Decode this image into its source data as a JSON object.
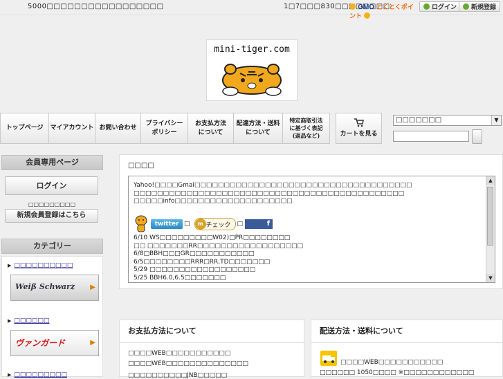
{
  "topbar": {
    "notice": "5000□□□□□□□□□□□□□□□□□",
    "ship_note": "1□7□□□830□□□□□□□□",
    "gmo_logo": "GMO",
    "gmo_points": "とくとくポイント",
    "login": "ログイン",
    "register": "新規登録"
  },
  "header": {
    "site_name": "mini-tiger.com"
  },
  "nav": {
    "items": [
      {
        "label": "トップページ"
      },
      {
        "label": "マイアカウント"
      },
      {
        "label": "お問い合わせ"
      },
      {
        "label": "プライバシー\nポリシー"
      },
      {
        "label": "お支払方法\nについて"
      },
      {
        "label": "配達方法・送料\nについて"
      },
      {
        "label": "特定商取引法\nに基づく表記\n(返品など)"
      }
    ],
    "cart_label": "カートを見る",
    "category_select": "□□□□□□□"
  },
  "sidebar": {
    "member_head": "会員専用ページ",
    "login_btn": "ログイン",
    "register_note": "□□□□□□□□□",
    "register_btn": "新規会員登録はこちら",
    "category_head": "カテゴリー",
    "categories": [
      {
        "label": "□□□□□□□□□□",
        "banner": "Weiß Schwarz"
      },
      {
        "label": "□□□□□□",
        "banner": "ヴァンガード"
      },
      {
        "label": "□□□□□□□□□"
      }
    ]
  },
  "news": {
    "title": "□□□□",
    "lines": [
      "Yahoo!□□□□Gmai□□□□□□□□□□□□□□□□□□□□□□□□□□□□□□□□□□□□□",
      "□□□□□□□□□□□□□□□□□□□□□□□□□□□□□□□□□□□□□□□□□□□□□□",
      "□□□□□info□□□□□□□□□□□□□□□□□□□□"
    ],
    "share": {
      "twitter": "twitter",
      "mixi": "チェック",
      "facebook": "f",
      "sep": "□"
    },
    "updates": [
      "6/10 WS□□□□□□□□□W02)□PR□□□□□□□□",
      "□□ □□□□□□□RR□□□□□□□□□□□□□□□□□□",
      "6/8□BBH□□□GR□□□□□□□□□□□",
      "6/5□□□□□□□□RRR□RR,TD□□□□□□□",
      "5/29 □□□□□□□□□□□□□□□□□□",
      "5/25 BBH6.0,6.5□□□□□□□"
    ]
  },
  "payment": {
    "head": "お支払方法について",
    "lines": [
      "□□□□WEB□□□□□□□□□□□",
      "□□□□WEB□□□□□□□□□□□□□□",
      "□□□□□□□□□□JNB□□□□□"
    ]
  },
  "shipping": {
    "head": "配送方法・送料について",
    "lines": [
      "□□□□WEB□□□□□□□□□□□",
      "□□□□□□ 1050□□□□ ※□□□□□□□□□□□□"
    ]
  },
  "colors": {
    "gmo_blue": "#1c3d8e",
    "gmo_orange": "#e9690f",
    "twitter": "#2c89c6",
    "facebook": "#3b5b9a",
    "truck": "#f6c400"
  },
  "icons": [
    "tiger-logo-icon",
    "cart-icon",
    "gmo-point-icon",
    "login-icon",
    "register-icon",
    "tiger-mascot-icon",
    "truck-icon",
    "dropdown-arrow-icon"
  ]
}
